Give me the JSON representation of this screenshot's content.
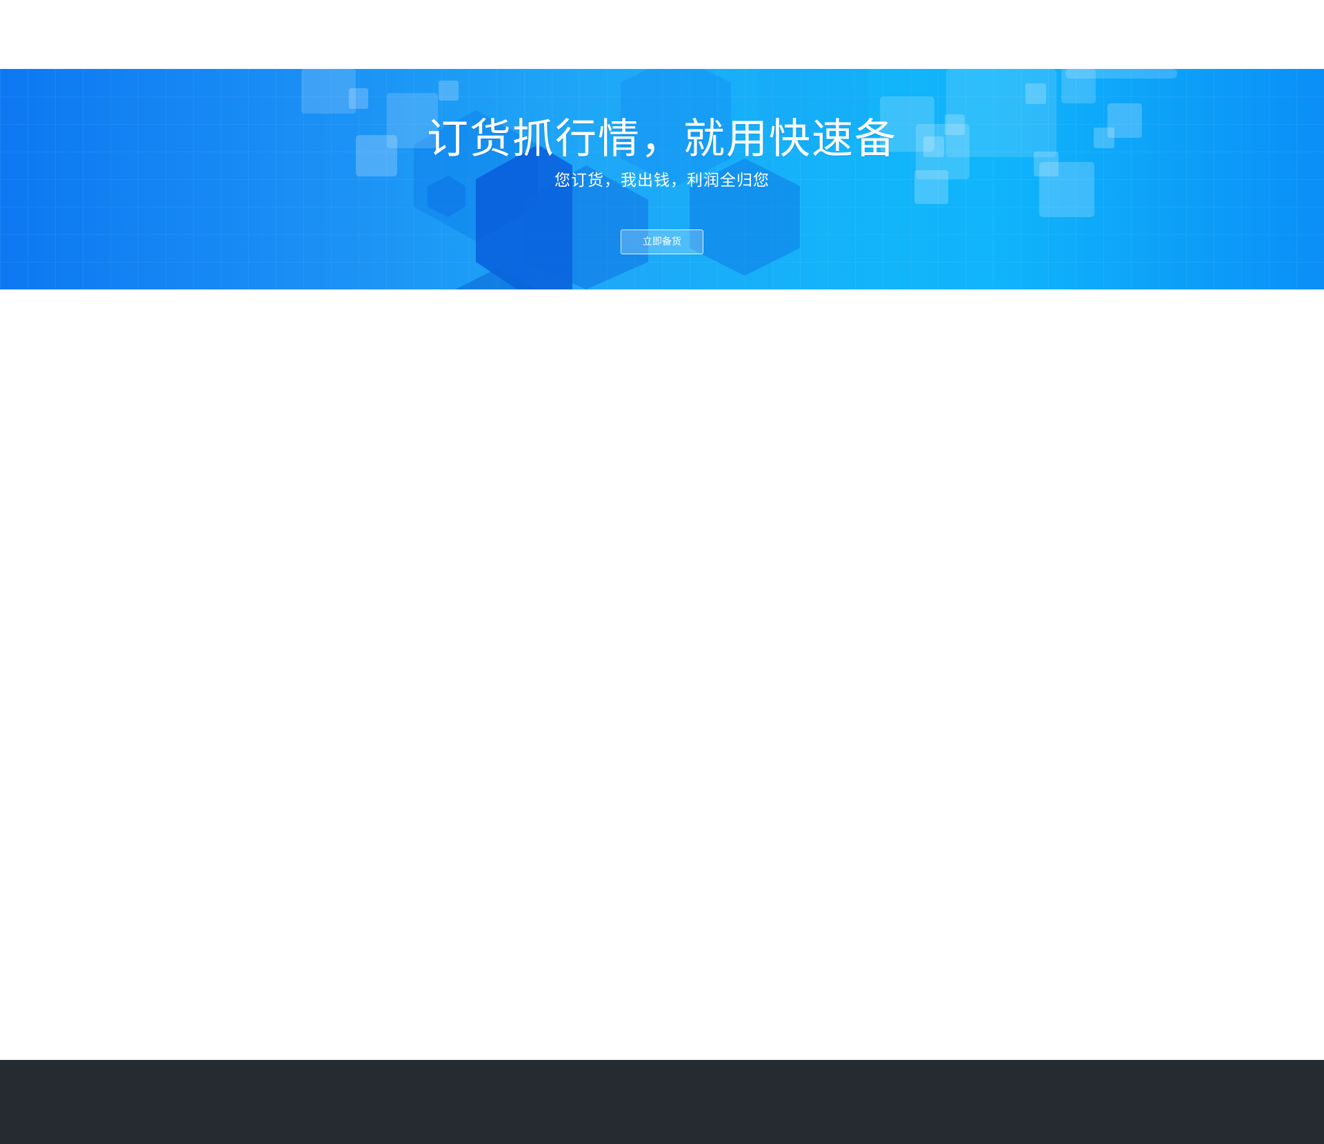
{
  "hero": {
    "title": "订货抓行情，就用快速备",
    "subtitle": "您订货，我出钱，利润全归您",
    "button_label": "立即备货"
  },
  "colors": {
    "hero_gradient_start": "#0d78f2",
    "hero_gradient_mid": "#14b3fa",
    "hero_gradient_end": "#0a8ff7",
    "footer_bg": "#262a31",
    "page_bg": "#ffffff",
    "text_light": "#ffffff"
  }
}
